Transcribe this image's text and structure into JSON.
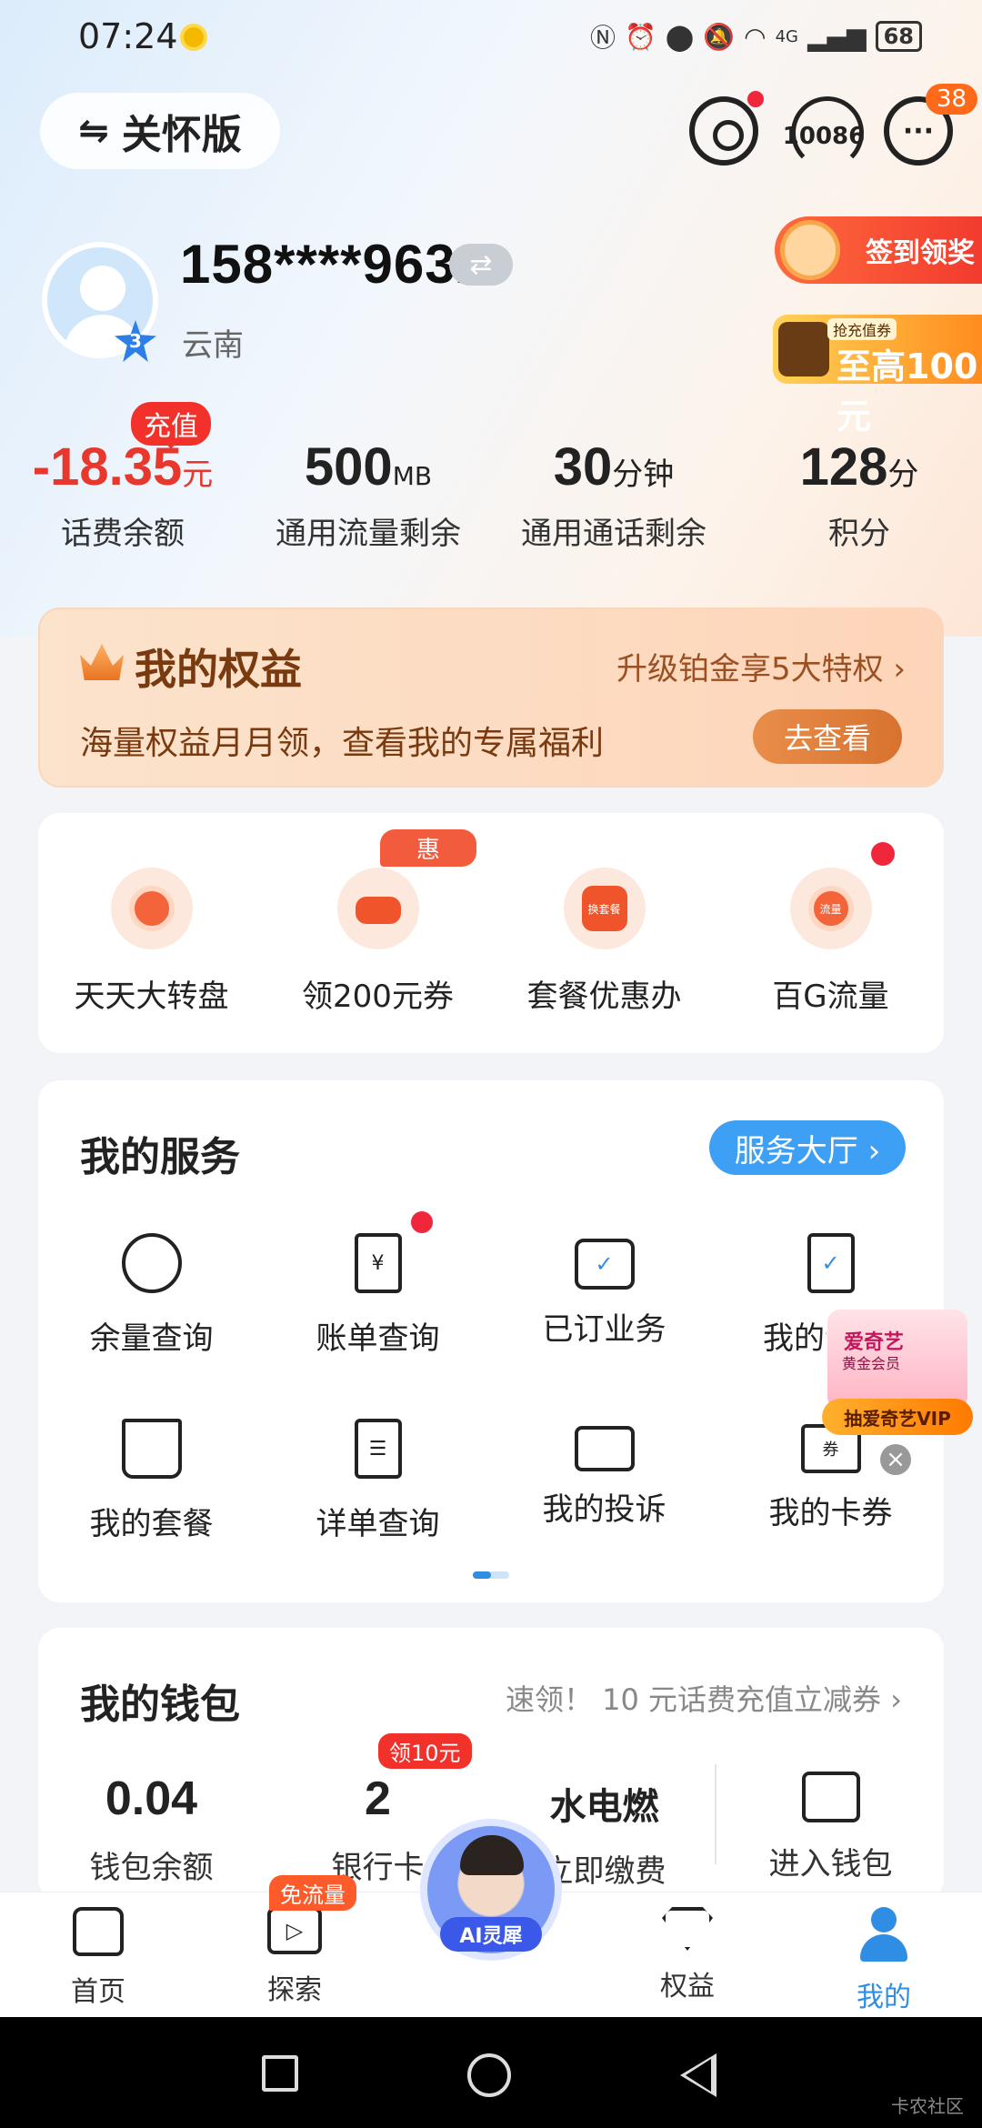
{
  "status_bar": {
    "time": "07:24",
    "battery": "68",
    "signal_label": "4G"
  },
  "top_bar": {
    "care_mode_label": "关怀版",
    "hotline": "10086",
    "message_count": "38"
  },
  "profile": {
    "phone": "158****9632",
    "region": "云南",
    "level": "3",
    "signin_label": "签到领奖",
    "recharge_promo_small": "抢充值券",
    "recharge_promo_big": "至高100元"
  },
  "stats": {
    "recharge_tag": "充值",
    "items": [
      {
        "value": "-18.35",
        "unit": "元",
        "label": "话费余额"
      },
      {
        "value": "500",
        "unit": "MB",
        "label": "通用流量剩余"
      },
      {
        "value": "30",
        "unit": "分钟",
        "label": "通用通话剩余"
      },
      {
        "value": "128",
        "unit": "分",
        "label": "积分"
      }
    ]
  },
  "benefits": {
    "title": "我的权益",
    "upgrade": "升级铂金享5大特权 ›",
    "desc": "海量权益月月领，查看我的专属福利",
    "go_label": "去查看"
  },
  "promo_row": {
    "hui_tag": "惠",
    "items": [
      {
        "label": "天天大转盘",
        "icon": "wheel-icon"
      },
      {
        "label": "领200元券",
        "icon": "router-icon"
      },
      {
        "label": "套餐优惠办",
        "icon": "shopping-bag-icon",
        "icon_text": "换套餐"
      },
      {
        "label": "百G流量",
        "icon": "money-bag-icon",
        "icon_text": "流量"
      }
    ]
  },
  "services": {
    "title": "我的服务",
    "hall_label": "服务大厅 ›",
    "items": [
      {
        "label": "余量查询",
        "icon": "pie-chart-icon"
      },
      {
        "label": "账单查询",
        "icon": "bill-icon"
      },
      {
        "label": "已订业务",
        "icon": "briefcase-check-icon"
      },
      {
        "label": "我的订单",
        "icon": "clipboard-check-icon"
      },
      {
        "label": "我的套餐",
        "icon": "bag-icon"
      },
      {
        "label": "详单查询",
        "icon": "list-icon"
      },
      {
        "label": "我的投诉",
        "icon": "chat-box-icon"
      },
      {
        "label": "我的卡券",
        "icon": "coupon-icon",
        "icon_text": "券"
      }
    ]
  },
  "iqiyi_ad": {
    "line1": "爱奇艺",
    "line2": "黄金会员",
    "banner": "抽爱奇艺VIP",
    "close": "×"
  },
  "wallet": {
    "title": "我的钱包",
    "promo": "速领！ 10 元话费充值立减券 ›",
    "ten_tag": "领10元",
    "items": [
      {
        "value": "0.04",
        "label": "钱包余额"
      },
      {
        "value": "2",
        "label": "银行卡"
      },
      {
        "value": "水电燃",
        "label": "立即缴费"
      },
      {
        "value": "",
        "label": "进入钱包"
      }
    ]
  },
  "bottom_nav": {
    "free_tag": "免流量",
    "ai_label": "AI灵犀",
    "items": [
      {
        "label": "首页"
      },
      {
        "label": "探索"
      },
      {
        "label": "权益"
      },
      {
        "label": "我的"
      }
    ]
  },
  "watermark": "卡农社区",
  "colors": {
    "accent_blue": "#2f8de4",
    "alert_red": "#e8382d",
    "benefit_brown": "#7a3a10"
  }
}
